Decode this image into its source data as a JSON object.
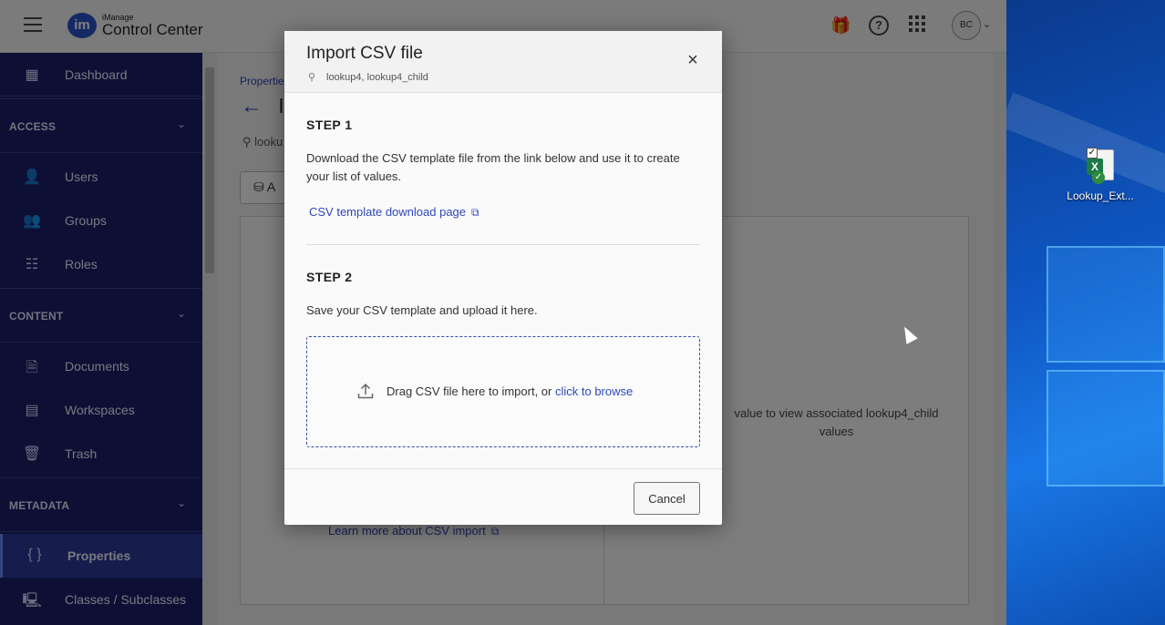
{
  "app": {
    "brand_small": "iManage",
    "brand_big": "Control Center",
    "logo_text": "im",
    "avatar_initials": "BC"
  },
  "sidebar": {
    "dashboard": "Dashboard",
    "sections": [
      {
        "label": "ACCESS",
        "items": [
          "Users",
          "Groups",
          "Roles"
        ]
      },
      {
        "label": "CONTENT",
        "items": [
          "Documents",
          "Workspaces",
          "Trash"
        ]
      },
      {
        "label": "METADATA",
        "items": [
          "Properties",
          "Classes / Subclasses"
        ]
      }
    ],
    "active_item": "Properties"
  },
  "background_page": {
    "breadcrumb": "Properties",
    "title_fragment": "l",
    "subtitle_fragment": "looku",
    "button_fragment": "A",
    "right_message": "value to view associated lookup4_child values",
    "learn_more": "Learn more about CSV import"
  },
  "modal": {
    "title": "Import CSV file",
    "subtitle": "lookup4, lookup4_child",
    "step1_heading": "STEP 1",
    "step1_text": "Download the CSV template file from the link below and use it to create your list of values.",
    "download_link": "CSV template download page",
    "step2_heading": "STEP 2",
    "step2_text": "Save your CSV template and upload it here.",
    "drop_text": "Drag CSV file here to import, or",
    "browse_link": "click to browse",
    "cancel_label": "Cancel"
  },
  "desktop": {
    "file_label": "Lookup_Ext..."
  },
  "colors": {
    "sidebar_bg": "#1a1f6b",
    "link": "#2f47b8",
    "desktop_bg": "#0f57c4"
  }
}
